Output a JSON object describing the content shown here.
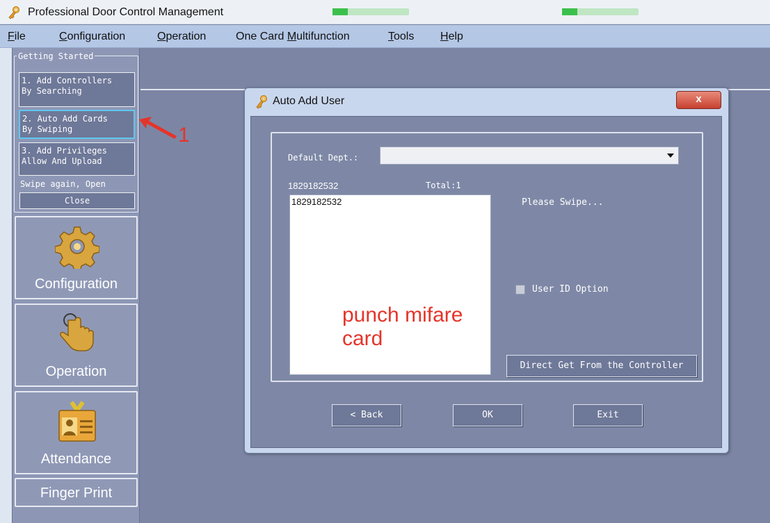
{
  "window": {
    "title": "Professional Door Control Management"
  },
  "menu": [
    {
      "pre": "",
      "u": "F",
      "post": "ile"
    },
    {
      "pre": "",
      "u": "C",
      "post": "onfiguration"
    },
    {
      "pre": "",
      "u": "O",
      "post": "peration"
    },
    {
      "pre": "One Card ",
      "u": "M",
      "post": "ultifunction"
    },
    {
      "pre": "",
      "u": "T",
      "post": "ools"
    },
    {
      "pre": "",
      "u": "H",
      "post": "elp"
    }
  ],
  "getting_started": {
    "legend": "Getting Started",
    "steps": [
      {
        "line1": "1. Add Controllers",
        "line2": "By Searching"
      },
      {
        "line1": "2. Auto Add Cards",
        "line2": "By Swiping"
      },
      {
        "line1": "3. Add Privileges",
        "line2": "Allow And Upload"
      }
    ],
    "swipe_note": "Swipe again, Open",
    "close_label": "Close"
  },
  "sidebar_buttons": {
    "configuration": "Configuration",
    "operation": "Operation",
    "attendance": "Attendance",
    "finger_print": "Finger Print"
  },
  "annotation": {
    "step_number": "1",
    "card_hint": "punch mifare card"
  },
  "dialog": {
    "title": "Auto Add User",
    "close_symbol": "x",
    "dept_label": "Default Dept.:",
    "dept_value": "",
    "last_card": "1829182532",
    "total": "Total:1",
    "cards": [
      "1829182532"
    ],
    "status": "Please Swipe...",
    "user_id_option": "User ID Option",
    "direct_get": "Direct Get From the Controller",
    "back": "< Back",
    "ok": "OK",
    "exit": "Exit"
  },
  "colors": {
    "background": "#7c86a4",
    "menubar": "#b4c7e5",
    "button_fill": "#6e7898",
    "active_outline": "#5ec8f0",
    "annotation_red": "#e5342a"
  }
}
